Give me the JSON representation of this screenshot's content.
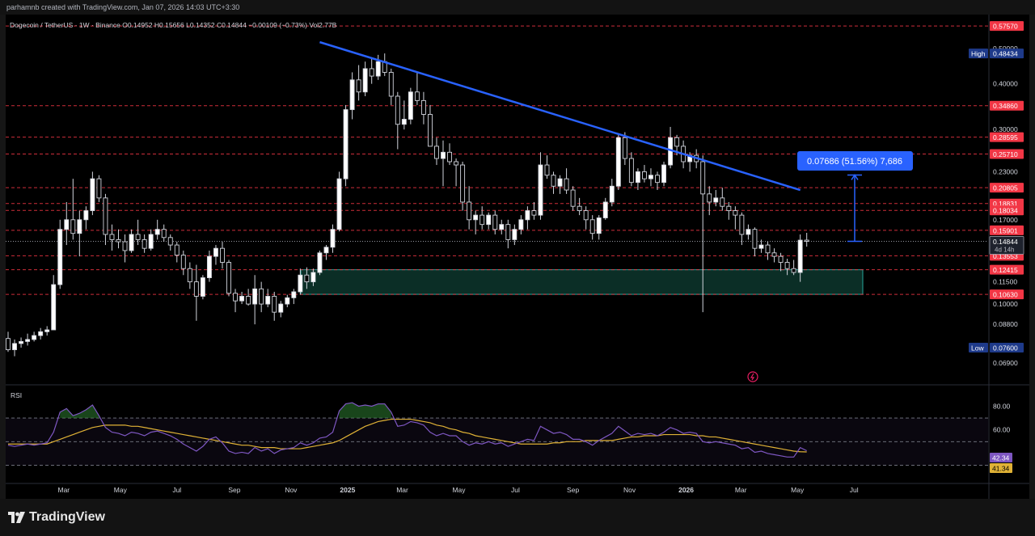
{
  "header": {
    "credit": "parhamnb created with TradingView.com, Jan 07, 2026 14:03 UTC+3:30",
    "symbol_line": "Dogecoin / TetherUS · 1W · Binance  O0.14952  H0.15656  L0.14352  C0.14844  −0.00109 (−0.73%)  Vol2.77B"
  },
  "footer": {
    "brand": "TradingView",
    "logo_icon": "tradingview-logo-icon"
  },
  "colors": {
    "background": "#000000",
    "candle_body": "#ffffff",
    "trendline": "#2962ff",
    "resistance_line": "#f23645",
    "zone_fill": "#0b2e26",
    "zone_border": "#26a69a",
    "rsi_line": "#7e57c2",
    "rsi_ma": "#e0b236",
    "rsi_overbought_fill": "#2e7d32",
    "measure_bg": "#2962ff"
  },
  "chart_data": {
    "type": "candlestick",
    "title": "Dogecoin / TetherUS · 1W · Binance",
    "price_axis_scale": "log",
    "ylim": [
      0.062,
      0.6
    ],
    "x_axis_labels": [
      "Mar",
      "May",
      "Jul",
      "Sep",
      "Nov",
      "2025",
      "Mar",
      "May",
      "Jul",
      "Sep",
      "Nov",
      "2026",
      "Mar",
      "May",
      "Jul"
    ],
    "y_tick_labels": [
      "0.50000",
      "0.40000",
      "0.30000",
      "0.23000",
      "0.17000",
      "0.11500",
      "0.10000",
      "0.08800",
      "0.06900"
    ],
    "resistance_levels": [
      "0.57570",
      "0.34860",
      "0.28595",
      "0.25710",
      "0.20805",
      "0.18831",
      "0.18034",
      "0.15901",
      "0.13553",
      "0.12415",
      "0.10630"
    ],
    "current_price": {
      "value": "0.14844",
      "countdown": "4d 14h"
    },
    "high": {
      "label": "High",
      "value": "0.48434"
    },
    "low": {
      "label": "Low",
      "value": "0.07600"
    },
    "measure": {
      "label": "0.07686 (51.56%) 7,686",
      "from": 0.1484,
      "to": 0.2253
    },
    "support_zone": {
      "low": 0.1063,
      "high": 0.1241
    },
    "trendline": {
      "from_date": "2024-12-02",
      "from_price": 0.52,
      "to_date": "2026-05-04",
      "to_price": 0.205
    },
    "start_week": "2024-01-01",
    "candles": [
      [
        0.0805,
        0.084,
        0.074,
        0.075
      ],
      [
        0.075,
        0.08,
        0.072,
        0.078
      ],
      [
        0.078,
        0.081,
        0.076,
        0.079
      ],
      [
        0.079,
        0.083,
        0.077,
        0.08
      ],
      [
        0.08,
        0.084,
        0.079,
        0.082
      ],
      [
        0.082,
        0.086,
        0.08,
        0.084
      ],
      [
        0.084,
        0.087,
        0.082,
        0.085
      ],
      [
        0.085,
        0.12,
        0.085,
        0.113
      ],
      [
        0.113,
        0.17,
        0.11,
        0.16
      ],
      [
        0.16,
        0.19,
        0.145,
        0.17
      ],
      [
        0.17,
        0.22,
        0.15,
        0.156
      ],
      [
        0.156,
        0.18,
        0.135,
        0.17
      ],
      [
        0.17,
        0.185,
        0.16,
        0.18
      ],
      [
        0.18,
        0.23,
        0.175,
        0.22
      ],
      [
        0.22,
        0.225,
        0.19,
        0.195
      ],
      [
        0.195,
        0.2,
        0.145,
        0.155
      ],
      [
        0.155,
        0.165,
        0.14,
        0.15
      ],
      [
        0.15,
        0.16,
        0.142,
        0.148
      ],
      [
        0.148,
        0.155,
        0.13,
        0.14
      ],
      [
        0.14,
        0.16,
        0.138,
        0.155
      ],
      [
        0.155,
        0.17,
        0.145,
        0.15
      ],
      [
        0.15,
        0.155,
        0.138,
        0.142
      ],
      [
        0.142,
        0.16,
        0.14,
        0.155
      ],
      [
        0.155,
        0.17,
        0.15,
        0.16
      ],
      [
        0.16,
        0.165,
        0.148,
        0.152
      ],
      [
        0.152,
        0.155,
        0.14,
        0.145
      ],
      [
        0.145,
        0.148,
        0.13,
        0.136
      ],
      [
        0.136,
        0.14,
        0.12,
        0.125
      ],
      [
        0.125,
        0.13,
        0.11,
        0.115
      ],
      [
        0.115,
        0.128,
        0.09,
        0.105
      ],
      [
        0.105,
        0.12,
        0.103,
        0.118
      ],
      [
        0.118,
        0.14,
        0.115,
        0.135
      ],
      [
        0.135,
        0.145,
        0.128,
        0.142
      ],
      [
        0.142,
        0.148,
        0.125,
        0.13
      ],
      [
        0.13,
        0.132,
        0.105,
        0.107
      ],
      [
        0.107,
        0.11,
        0.095,
        0.102
      ],
      [
        0.102,
        0.108,
        0.1,
        0.105
      ],
      [
        0.105,
        0.11,
        0.099,
        0.1
      ],
      [
        0.1,
        0.12,
        0.088,
        0.11
      ],
      [
        0.11,
        0.115,
        0.095,
        0.1
      ],
      [
        0.1,
        0.11,
        0.098,
        0.105
      ],
      [
        0.105,
        0.108,
        0.09,
        0.095
      ],
      [
        0.095,
        0.102,
        0.092,
        0.1
      ],
      [
        0.1,
        0.106,
        0.098,
        0.104
      ],
      [
        0.104,
        0.11,
        0.1,
        0.108
      ],
      [
        0.108,
        0.125,
        0.106,
        0.12
      ],
      [
        0.12,
        0.126,
        0.11,
        0.115
      ],
      [
        0.115,
        0.125,
        0.112,
        0.122
      ],
      [
        0.122,
        0.14,
        0.12,
        0.138
      ],
      [
        0.138,
        0.145,
        0.132,
        0.143
      ],
      [
        0.143,
        0.165,
        0.138,
        0.16
      ],
      [
        0.16,
        0.23,
        0.158,
        0.22
      ],
      [
        0.22,
        0.35,
        0.21,
        0.34
      ],
      [
        0.34,
        0.43,
        0.32,
        0.41
      ],
      [
        0.41,
        0.45,
        0.36,
        0.38
      ],
      [
        0.38,
        0.46,
        0.37,
        0.44
      ],
      [
        0.44,
        0.47,
        0.4,
        0.42
      ],
      [
        0.42,
        0.48,
        0.41,
        0.46
      ],
      [
        0.46,
        0.4843,
        0.42,
        0.43
      ],
      [
        0.43,
        0.44,
        0.35,
        0.37
      ],
      [
        0.37,
        0.38,
        0.265,
        0.31
      ],
      [
        0.31,
        0.36,
        0.3,
        0.32
      ],
      [
        0.32,
        0.39,
        0.31,
        0.38
      ],
      [
        0.38,
        0.43,
        0.35,
        0.36
      ],
      [
        0.36,
        0.38,
        0.31,
        0.33
      ],
      [
        0.33,
        0.35,
        0.28,
        0.27
      ],
      [
        0.27,
        0.285,
        0.24,
        0.25
      ],
      [
        0.25,
        0.28,
        0.21,
        0.26
      ],
      [
        0.26,
        0.275,
        0.24,
        0.245
      ],
      [
        0.245,
        0.25,
        0.21,
        0.24
      ],
      [
        0.24,
        0.245,
        0.18,
        0.19
      ],
      [
        0.19,
        0.21,
        0.16,
        0.17
      ],
      [
        0.17,
        0.18,
        0.155,
        0.175
      ],
      [
        0.175,
        0.185,
        0.16,
        0.165
      ],
      [
        0.165,
        0.178,
        0.16,
        0.175
      ],
      [
        0.175,
        0.18,
        0.155,
        0.16
      ],
      [
        0.16,
        0.17,
        0.155,
        0.165
      ],
      [
        0.165,
        0.17,
        0.142,
        0.15
      ],
      [
        0.15,
        0.165,
        0.145,
        0.16
      ],
      [
        0.16,
        0.175,
        0.155,
        0.17
      ],
      [
        0.17,
        0.185,
        0.16,
        0.18
      ],
      [
        0.18,
        0.19,
        0.17,
        0.175
      ],
      [
        0.175,
        0.26,
        0.17,
        0.24
      ],
      [
        0.24,
        0.255,
        0.22,
        0.225
      ],
      [
        0.225,
        0.23,
        0.2,
        0.21
      ],
      [
        0.21,
        0.225,
        0.2,
        0.22
      ],
      [
        0.22,
        0.235,
        0.2,
        0.205
      ],
      [
        0.205,
        0.21,
        0.18,
        0.185
      ],
      [
        0.185,
        0.195,
        0.175,
        0.18
      ],
      [
        0.18,
        0.185,
        0.16,
        0.17
      ],
      [
        0.17,
        0.175,
        0.15,
        0.156
      ],
      [
        0.156,
        0.175,
        0.15,
        0.172
      ],
      [
        0.172,
        0.195,
        0.17,
        0.19
      ],
      [
        0.19,
        0.22,
        0.185,
        0.21
      ],
      [
        0.21,
        0.29,
        0.205,
        0.285
      ],
      [
        0.285,
        0.295,
        0.24,
        0.25
      ],
      [
        0.25,
        0.26,
        0.21,
        0.215
      ],
      [
        0.215,
        0.235,
        0.205,
        0.23
      ],
      [
        0.23,
        0.24,
        0.215,
        0.22
      ],
      [
        0.22,
        0.235,
        0.21,
        0.225
      ],
      [
        0.225,
        0.23,
        0.205,
        0.215
      ],
      [
        0.215,
        0.245,
        0.21,
        0.24
      ],
      [
        0.24,
        0.305,
        0.235,
        0.285
      ],
      [
        0.285,
        0.29,
        0.255,
        0.27
      ],
      [
        0.27,
        0.28,
        0.235,
        0.245
      ],
      [
        0.245,
        0.26,
        0.23,
        0.255
      ],
      [
        0.255,
        0.265,
        0.235,
        0.245
      ],
      [
        0.245,
        0.255,
        0.095,
        0.2
      ],
      [
        0.2,
        0.21,
        0.175,
        0.19
      ],
      [
        0.19,
        0.205,
        0.185,
        0.195
      ],
      [
        0.195,
        0.208,
        0.18,
        0.185
      ],
      [
        0.185,
        0.19,
        0.17,
        0.18
      ],
      [
        0.18,
        0.185,
        0.16,
        0.175
      ],
      [
        0.175,
        0.178,
        0.145,
        0.155
      ],
      [
        0.155,
        0.165,
        0.15,
        0.16
      ],
      [
        0.16,
        0.162,
        0.135,
        0.142
      ],
      [
        0.142,
        0.15,
        0.138,
        0.145
      ],
      [
        0.145,
        0.148,
        0.132,
        0.138
      ],
      [
        0.138,
        0.142,
        0.13,
        0.135
      ],
      [
        0.135,
        0.138,
        0.123,
        0.13
      ],
      [
        0.13,
        0.133,
        0.12,
        0.125
      ],
      [
        0.125,
        0.132,
        0.12,
        0.122
      ],
      [
        0.122,
        0.155,
        0.115,
        0.1495
      ],
      [
        0.14952,
        0.15656,
        0.14352,
        0.14844
      ]
    ],
    "rsi": {
      "label": "RSI",
      "y_tick_labels": [
        "80.00",
        "60.00"
      ],
      "levels": [
        70,
        50,
        30
      ],
      "value": "42.34",
      "ma_value": "41.34",
      "values": [
        47,
        46,
        47,
        48,
        47,
        48,
        49,
        58,
        75,
        78,
        72,
        74,
        77,
        81,
        72,
        62,
        58,
        57,
        55,
        58,
        57,
        55,
        58,
        59,
        57,
        55,
        52,
        48,
        45,
        42,
        46,
        52,
        54,
        49,
        42,
        40,
        41,
        40,
        45,
        42,
        44,
        40,
        43,
        44,
        45,
        49,
        47,
        49,
        53,
        54,
        58,
        76,
        82,
        83,
        80,
        81,
        80,
        82,
        82,
        75,
        63,
        64,
        67,
        66,
        64,
        58,
        55,
        57,
        55,
        55,
        50,
        47,
        49,
        48,
        50,
        48,
        49,
        46,
        48,
        50,
        52,
        51,
        63,
        60,
        57,
        58,
        56,
        52,
        52,
        50,
        47,
        51,
        54,
        57,
        63,
        59,
        55,
        57,
        56,
        57,
        55,
        58,
        62,
        60,
        57,
        58,
        57,
        50,
        49,
        50,
        49,
        48,
        47,
        44,
        45,
        41,
        42,
        40,
        39,
        38,
        37,
        37,
        45,
        42.34
      ],
      "ma_values": [
        48,
        48,
        48,
        48,
        48,
        48,
        48,
        50,
        52,
        54,
        56,
        58,
        60,
        62,
        63,
        64,
        64,
        64,
        64,
        63,
        63,
        62,
        61,
        60,
        59,
        58,
        57,
        56,
        55,
        54,
        53,
        52,
        51,
        50,
        49,
        48,
        47,
        47,
        46,
        45,
        45,
        45,
        44,
        44,
        44,
        44,
        45,
        46,
        47,
        48,
        49,
        51,
        54,
        57,
        60,
        63,
        65,
        67,
        68,
        69,
        69,
        69,
        69,
        68,
        67,
        66,
        64,
        63,
        61,
        60,
        58,
        57,
        55,
        54,
        53,
        52,
        51,
        50,
        49,
        48,
        48,
        48,
        48,
        48,
        49,
        49,
        50,
        50,
        50,
        51,
        51,
        51,
        51,
        51,
        52,
        53,
        54,
        54,
        55,
        55,
        55,
        56,
        56,
        56,
        56,
        56,
        55,
        55,
        54,
        54,
        53,
        52,
        51,
        50,
        49,
        48,
        47,
        46,
        45,
        44,
        43,
        42,
        41.5,
        41.34
      ]
    }
  }
}
